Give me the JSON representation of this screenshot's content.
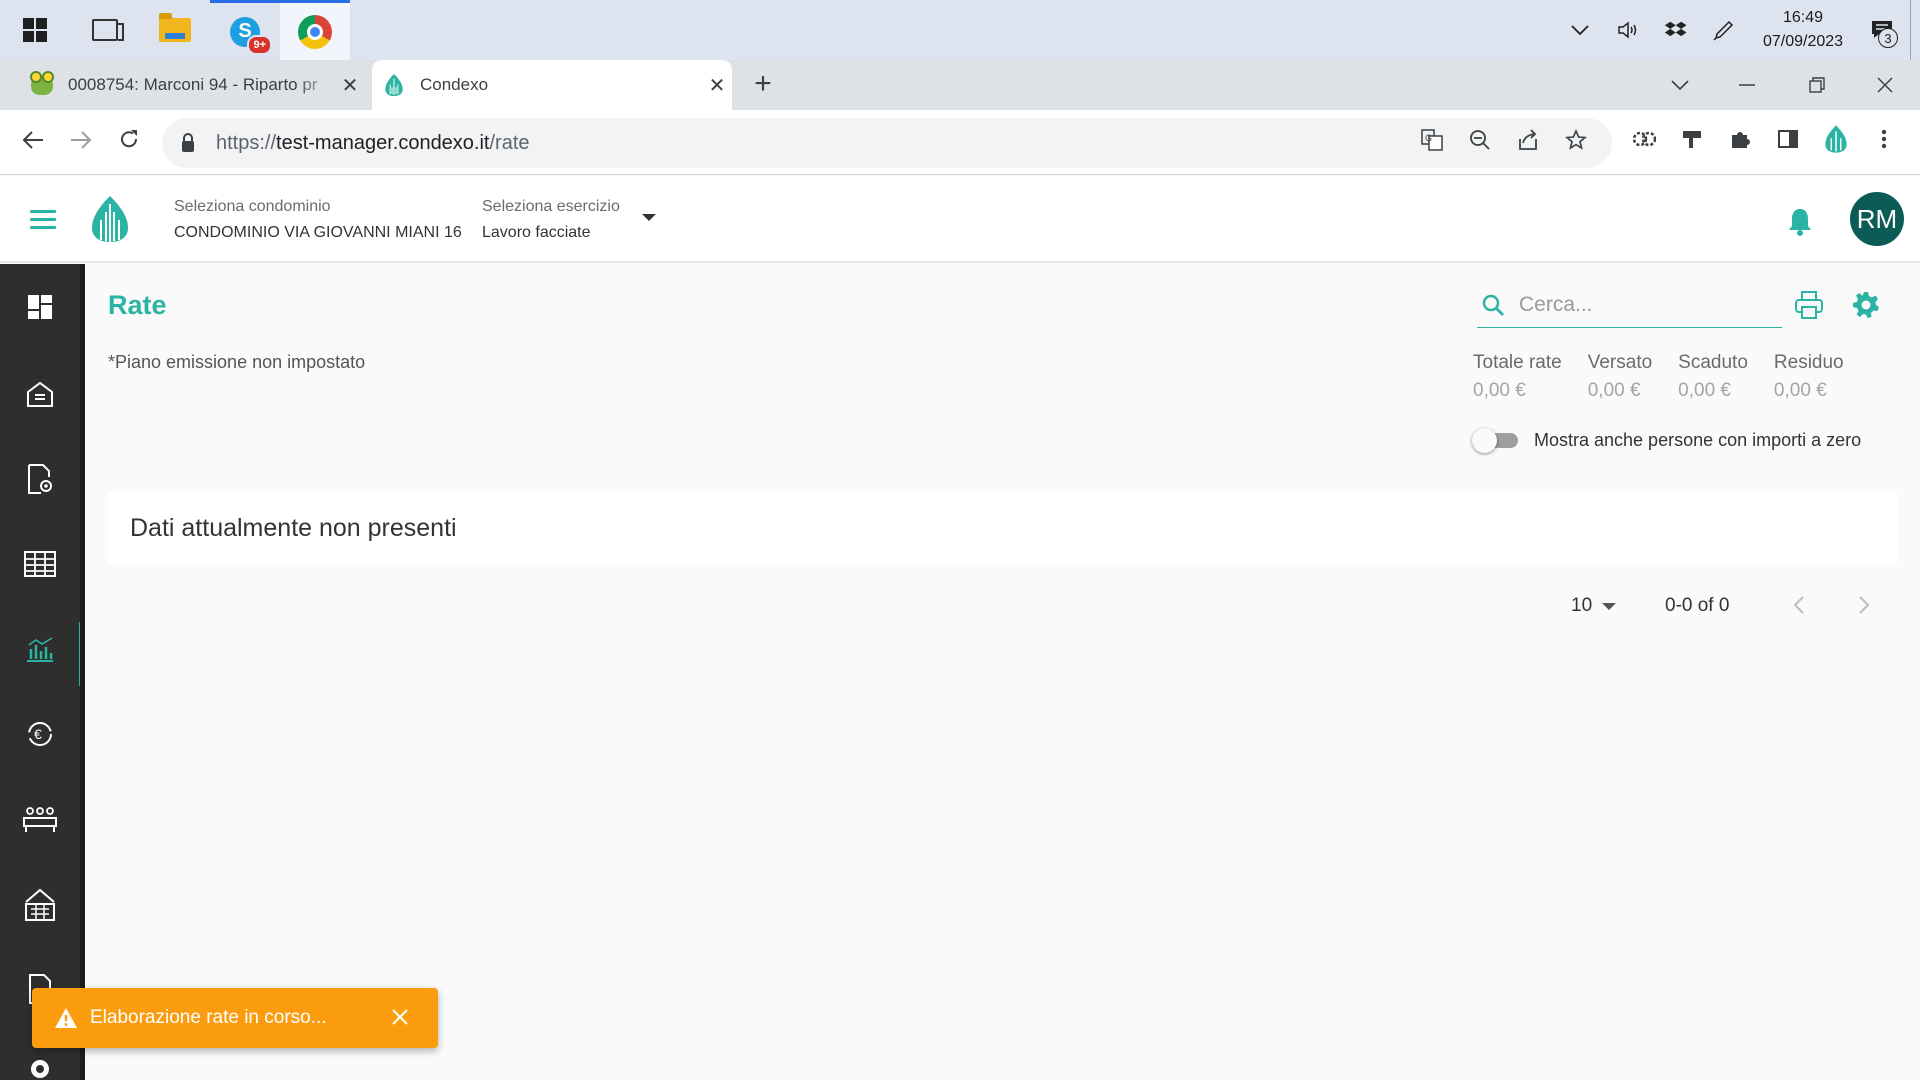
{
  "taskbar": {
    "skype_badge": "9+",
    "clock_time": "16:49",
    "clock_date": "07/09/2023",
    "notification_count": "3"
  },
  "browser": {
    "tabs": [
      {
        "title": "0008754: Marconi 94 - Riparto pr"
      },
      {
        "title": "Condexo"
      }
    ],
    "url": {
      "scheme": "https://",
      "host": "test-manager.condexo.it",
      "path": "/rate"
    }
  },
  "header": {
    "condominio_label": "Seleziona condominio",
    "condominio_value": "CONDOMINIO VIA GIOVANNI MIANI 16",
    "esercizio_label": "Seleziona esercizio",
    "esercizio_value": "Lavoro facciate",
    "avatar_initials": "RM"
  },
  "page": {
    "title": "Rate",
    "plan_note": "*Piano emissione non impostato",
    "search_placeholder": "Cerca...",
    "totals": [
      {
        "label": "Totale rate",
        "value": "0,00 €"
      },
      {
        "label": "Versato",
        "value": "0,00 €"
      },
      {
        "label": "Scaduto",
        "value": "0,00 €"
      },
      {
        "label": "Residuo",
        "value": "0,00 €"
      }
    ],
    "toggle_label": "Mostra anche persone con importi a zero",
    "toggle_on": false,
    "empty_message": "Dati attualmente non presenti",
    "pagination": {
      "page_size": "10",
      "range": "0-0 of 0"
    }
  },
  "snackbar": {
    "message": "Elaborazione rate in corso..."
  },
  "colors": {
    "accent": "#2bb3a3",
    "sidebar": "#2e2e2e",
    "warning": "#fb9c0e",
    "avatar": "#0b5c57"
  }
}
